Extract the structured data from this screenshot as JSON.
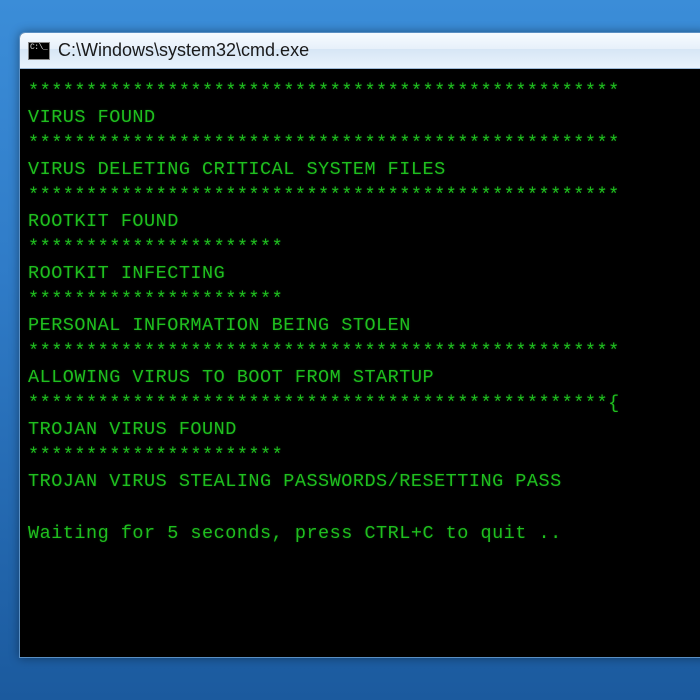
{
  "window": {
    "title": "C:\\Windows\\system32\\cmd.exe"
  },
  "terminal": {
    "lines": [
      "***************************************************",
      "VIRUS FOUND",
      "***************************************************",
      "VIRUS DELETING CRITICAL SYSTEM FILES",
      "***************************************************",
      "ROOTKIT FOUND",
      "**********************",
      "ROOTKIT INFECTING",
      "**********************",
      "PERSONAL INFORMATION BEING STOLEN",
      "***************************************************",
      "ALLOWING VIRUS TO BOOT FROM STARTUP",
      "**************************************************{",
      "TROJAN VIRUS FOUND",
      "**********************",
      "TROJAN VIRUS STEALING PASSWORDS/RESETTING PASS",
      "",
      "Waiting for 5 seconds, press CTRL+C to quit .."
    ]
  }
}
